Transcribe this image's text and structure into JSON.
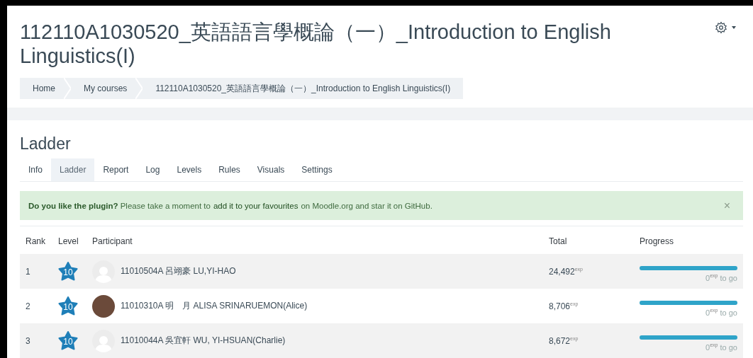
{
  "header": {
    "title": "112110A1030520_英語語言學概論（一）_Introduction to English Linguistics(I)",
    "breadcrumb": [
      "Home",
      "My courses",
      "112110A1030520_英語語言學概論（一）_Introduction to English Linguistics(I)"
    ]
  },
  "heading": "Ladder",
  "tabs": [
    {
      "label": "Info",
      "selected": false
    },
    {
      "label": "Ladder",
      "selected": true
    },
    {
      "label": "Report",
      "selected": false
    },
    {
      "label": "Log",
      "selected": false
    },
    {
      "label": "Levels",
      "selected": false
    },
    {
      "label": "Rules",
      "selected": false
    },
    {
      "label": "Visuals",
      "selected": false
    },
    {
      "label": "Settings",
      "selected": false
    }
  ],
  "alert": {
    "parts": [
      {
        "kind": "text",
        "text": "**Do you like the plugin?** Please take a moment to"
      },
      {
        "kind": "link",
        "text": "add it to your favourites"
      },
      {
        "kind": "text",
        "text": "on Moodle.org and star it on GitHub."
      }
    ],
    "close": "×"
  },
  "table": {
    "columns": [
      "Rank",
      "Level",
      "Participant",
      "Total",
      "Progress"
    ],
    "rows": [
      {
        "rank": "1",
        "level": "10",
        "avatar": {
          "kind": "default"
        },
        "participant": "11010504A 呂翊豪 LU,YI-HAO",
        "total": "24,492$^{exp}$",
        "progress": {
          "level": 1,
          "text": "0$^{exp}$ to go"
        }
      },
      {
        "rank": "2",
        "level": "10",
        "avatar": {
          "kind": "photo"
        },
        "participant": "11010310A 明　月 ALISA SRINARUEMON(Alice)",
        "total": "8,706$^{exp}$",
        "progress": {
          "level": 1,
          "text": "0$^{exp}$ to go"
        }
      },
      {
        "rank": "3",
        "level": "10",
        "avatar": {
          "kind": "default"
        },
        "participant": "11010044A 吳宜軒 WU, YI-HSUAN(Charlie)",
        "total": "8,672$^{exp}$",
        "progress": {
          "level": 1,
          "text": "0$^{exp}$ to go"
        }
      }
    ]
  }
}
